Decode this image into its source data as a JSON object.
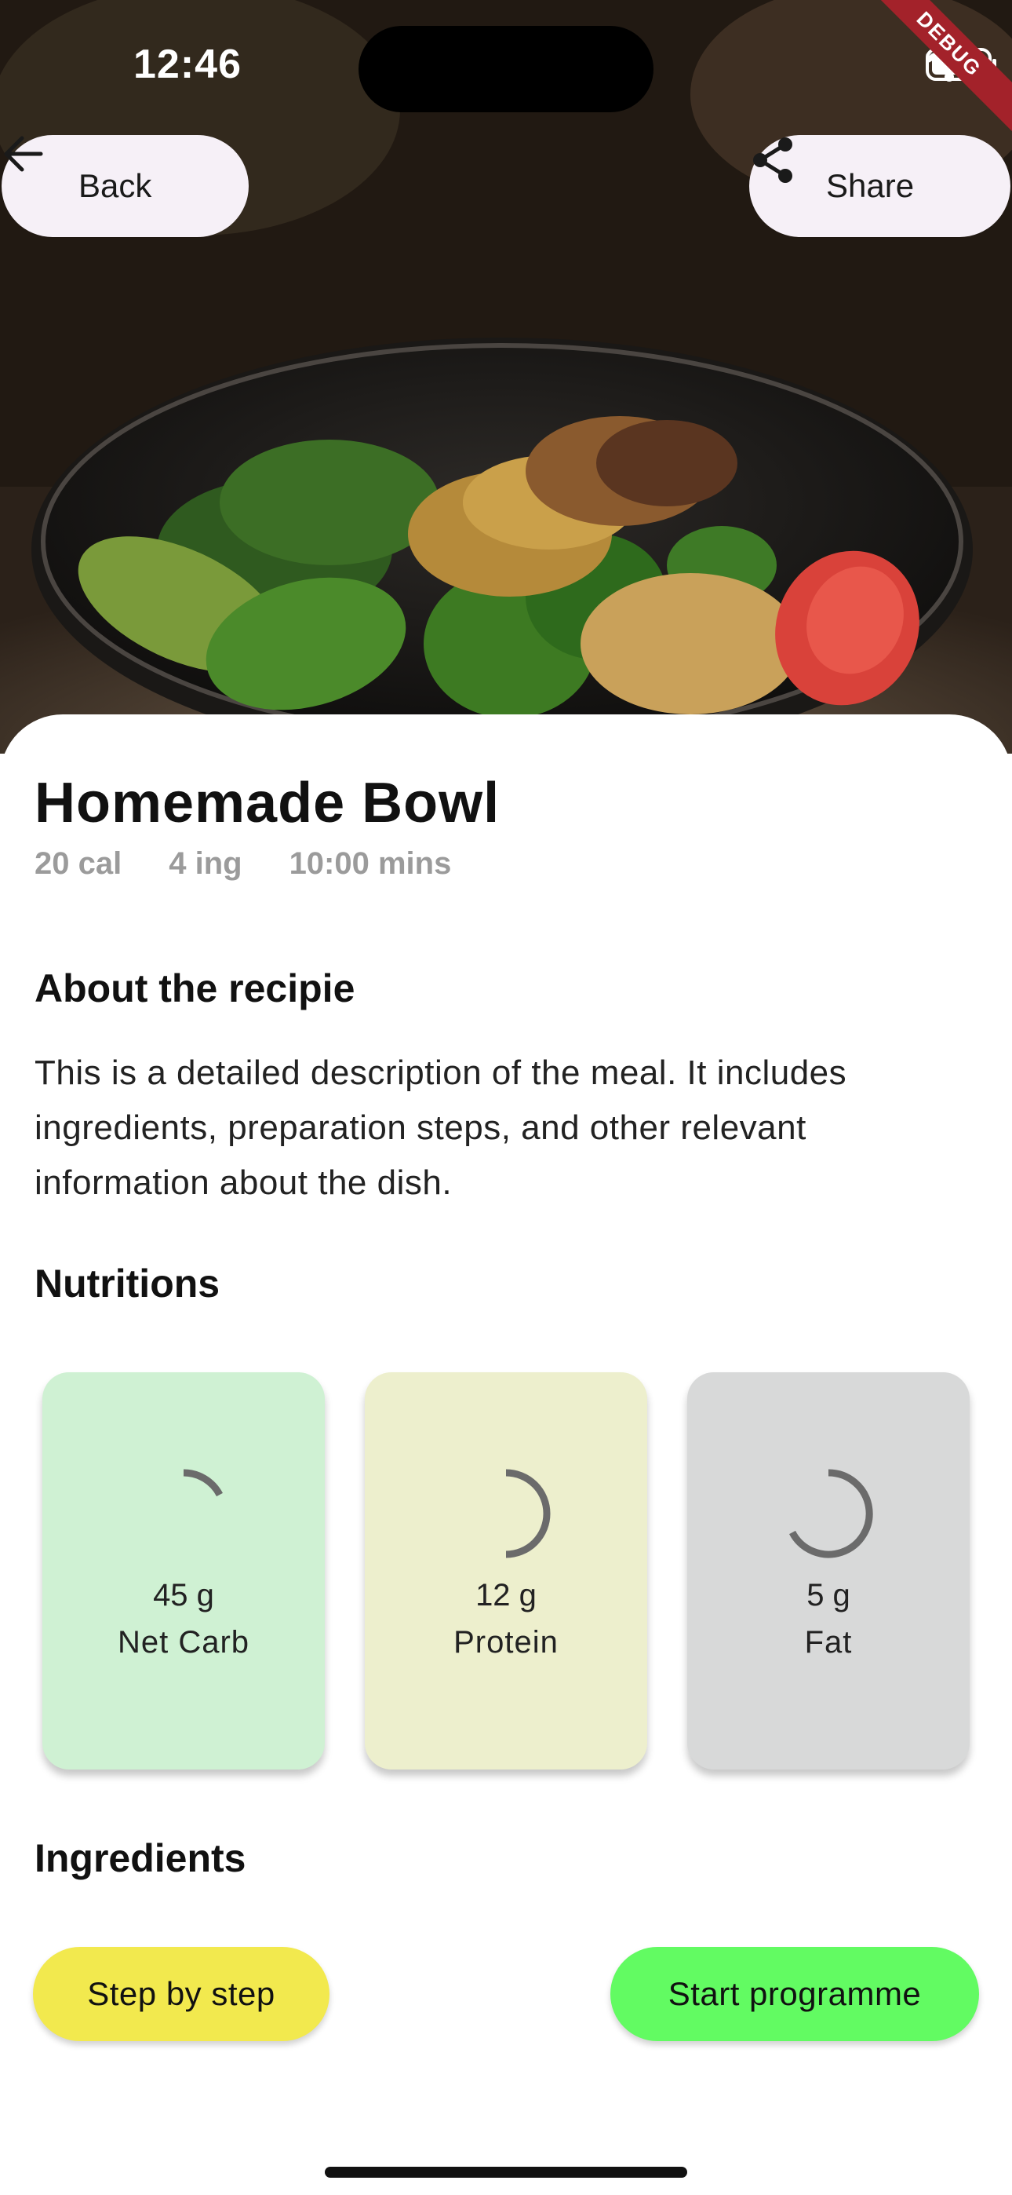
{
  "status_bar": {
    "time": "12:46",
    "debug_label": "DEBUG"
  },
  "header": {
    "back_label": "Back",
    "share_label": "Share"
  },
  "recipe": {
    "title": "Homemade Bowl",
    "meta": {
      "calories": "20 cal",
      "ingredients": "4 ing",
      "duration": "10:00 mins"
    },
    "about_heading": "About the recipie",
    "description": "This is a detailed description of the meal. It includes ingredients, preparation steps, and other relevant information about the dish.",
    "nutrition_heading": "Nutritions",
    "nutrition": [
      {
        "amount": "45 g",
        "name": "Net Carb",
        "color": "#cff1d3"
      },
      {
        "amount": "12 g",
        "name": "Protein",
        "color": "#edefcd"
      },
      {
        "amount": "5 g",
        "name": "Fat",
        "color": "#d8d9d9"
      }
    ],
    "ingredients_heading": "Ingredients"
  },
  "actions": {
    "step_label": "Step by step",
    "start_label": "Start programme",
    "step_color": "#f2e94e",
    "start_color": "#62fb62"
  },
  "icons": {
    "back": "arrow-left-icon",
    "share": "share-icon",
    "wifi": "wifi-icon",
    "battery": "battery-icon",
    "signal": "cellular-signal-icon"
  }
}
